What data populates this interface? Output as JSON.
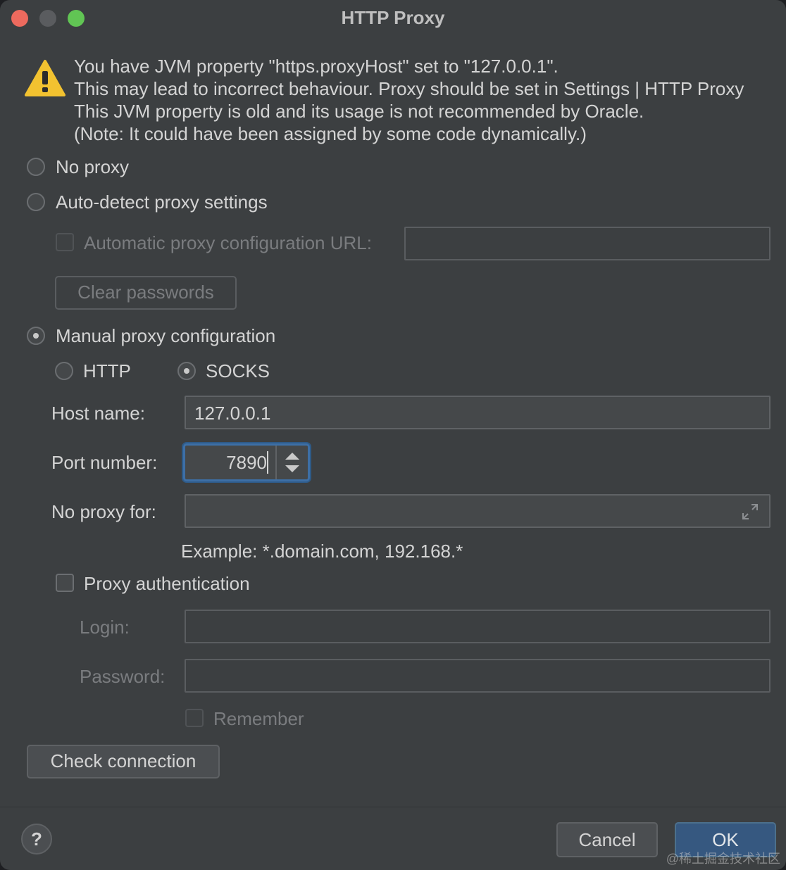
{
  "window": {
    "title": "HTTP Proxy"
  },
  "warning": {
    "icon": "warning-icon",
    "lines": [
      "You have JVM property \"https.proxyHost\" set to \"127.0.0.1\".",
      "This may lead to incorrect behaviour. Proxy should be set in Settings | HTTP Proxy",
      "This JVM property is old and its usage is not recommended by Oracle.",
      "(Note: It could have been assigned by some code dynamically.)"
    ]
  },
  "modes": {
    "no_proxy": {
      "label": "No proxy",
      "selected": false
    },
    "auto_detect": {
      "label": "Auto-detect proxy settings",
      "selected": false
    },
    "manual": {
      "label": "Manual proxy configuration",
      "selected": true
    }
  },
  "auto": {
    "pac_url_label": "Automatic proxy configuration URL:",
    "pac_url_checked": false,
    "pac_url_value": "",
    "clear_passwords_label": "Clear passwords"
  },
  "manual": {
    "protocols": {
      "http": {
        "label": "HTTP",
        "selected": false
      },
      "socks": {
        "label": "SOCKS",
        "selected": true
      }
    },
    "host_label": "Host name:",
    "host_value": "127.0.0.1",
    "port_label": "Port number:",
    "port_value": "7890",
    "no_proxy_label": "No proxy for:",
    "no_proxy_value": "",
    "example_text": "Example: *.domain.com, 192.168.*",
    "auth_label": "Proxy authentication",
    "auth_checked": false,
    "login_label": "Login:",
    "login_value": "",
    "password_label": "Password:",
    "password_value": "",
    "remember_label": "Remember",
    "remember_checked": false
  },
  "actions": {
    "check_connection": "Check connection",
    "help": "?",
    "cancel": "Cancel",
    "ok": "OK"
  },
  "watermark": "@稀土掘金技术社区",
  "colors": {
    "background": "#3c3f41",
    "primary_button": "#365880",
    "focus_ring": "#3d6fa6",
    "warning_yellow": "#f2c230",
    "close": "#ed6a5e",
    "zoom": "#61c554"
  }
}
